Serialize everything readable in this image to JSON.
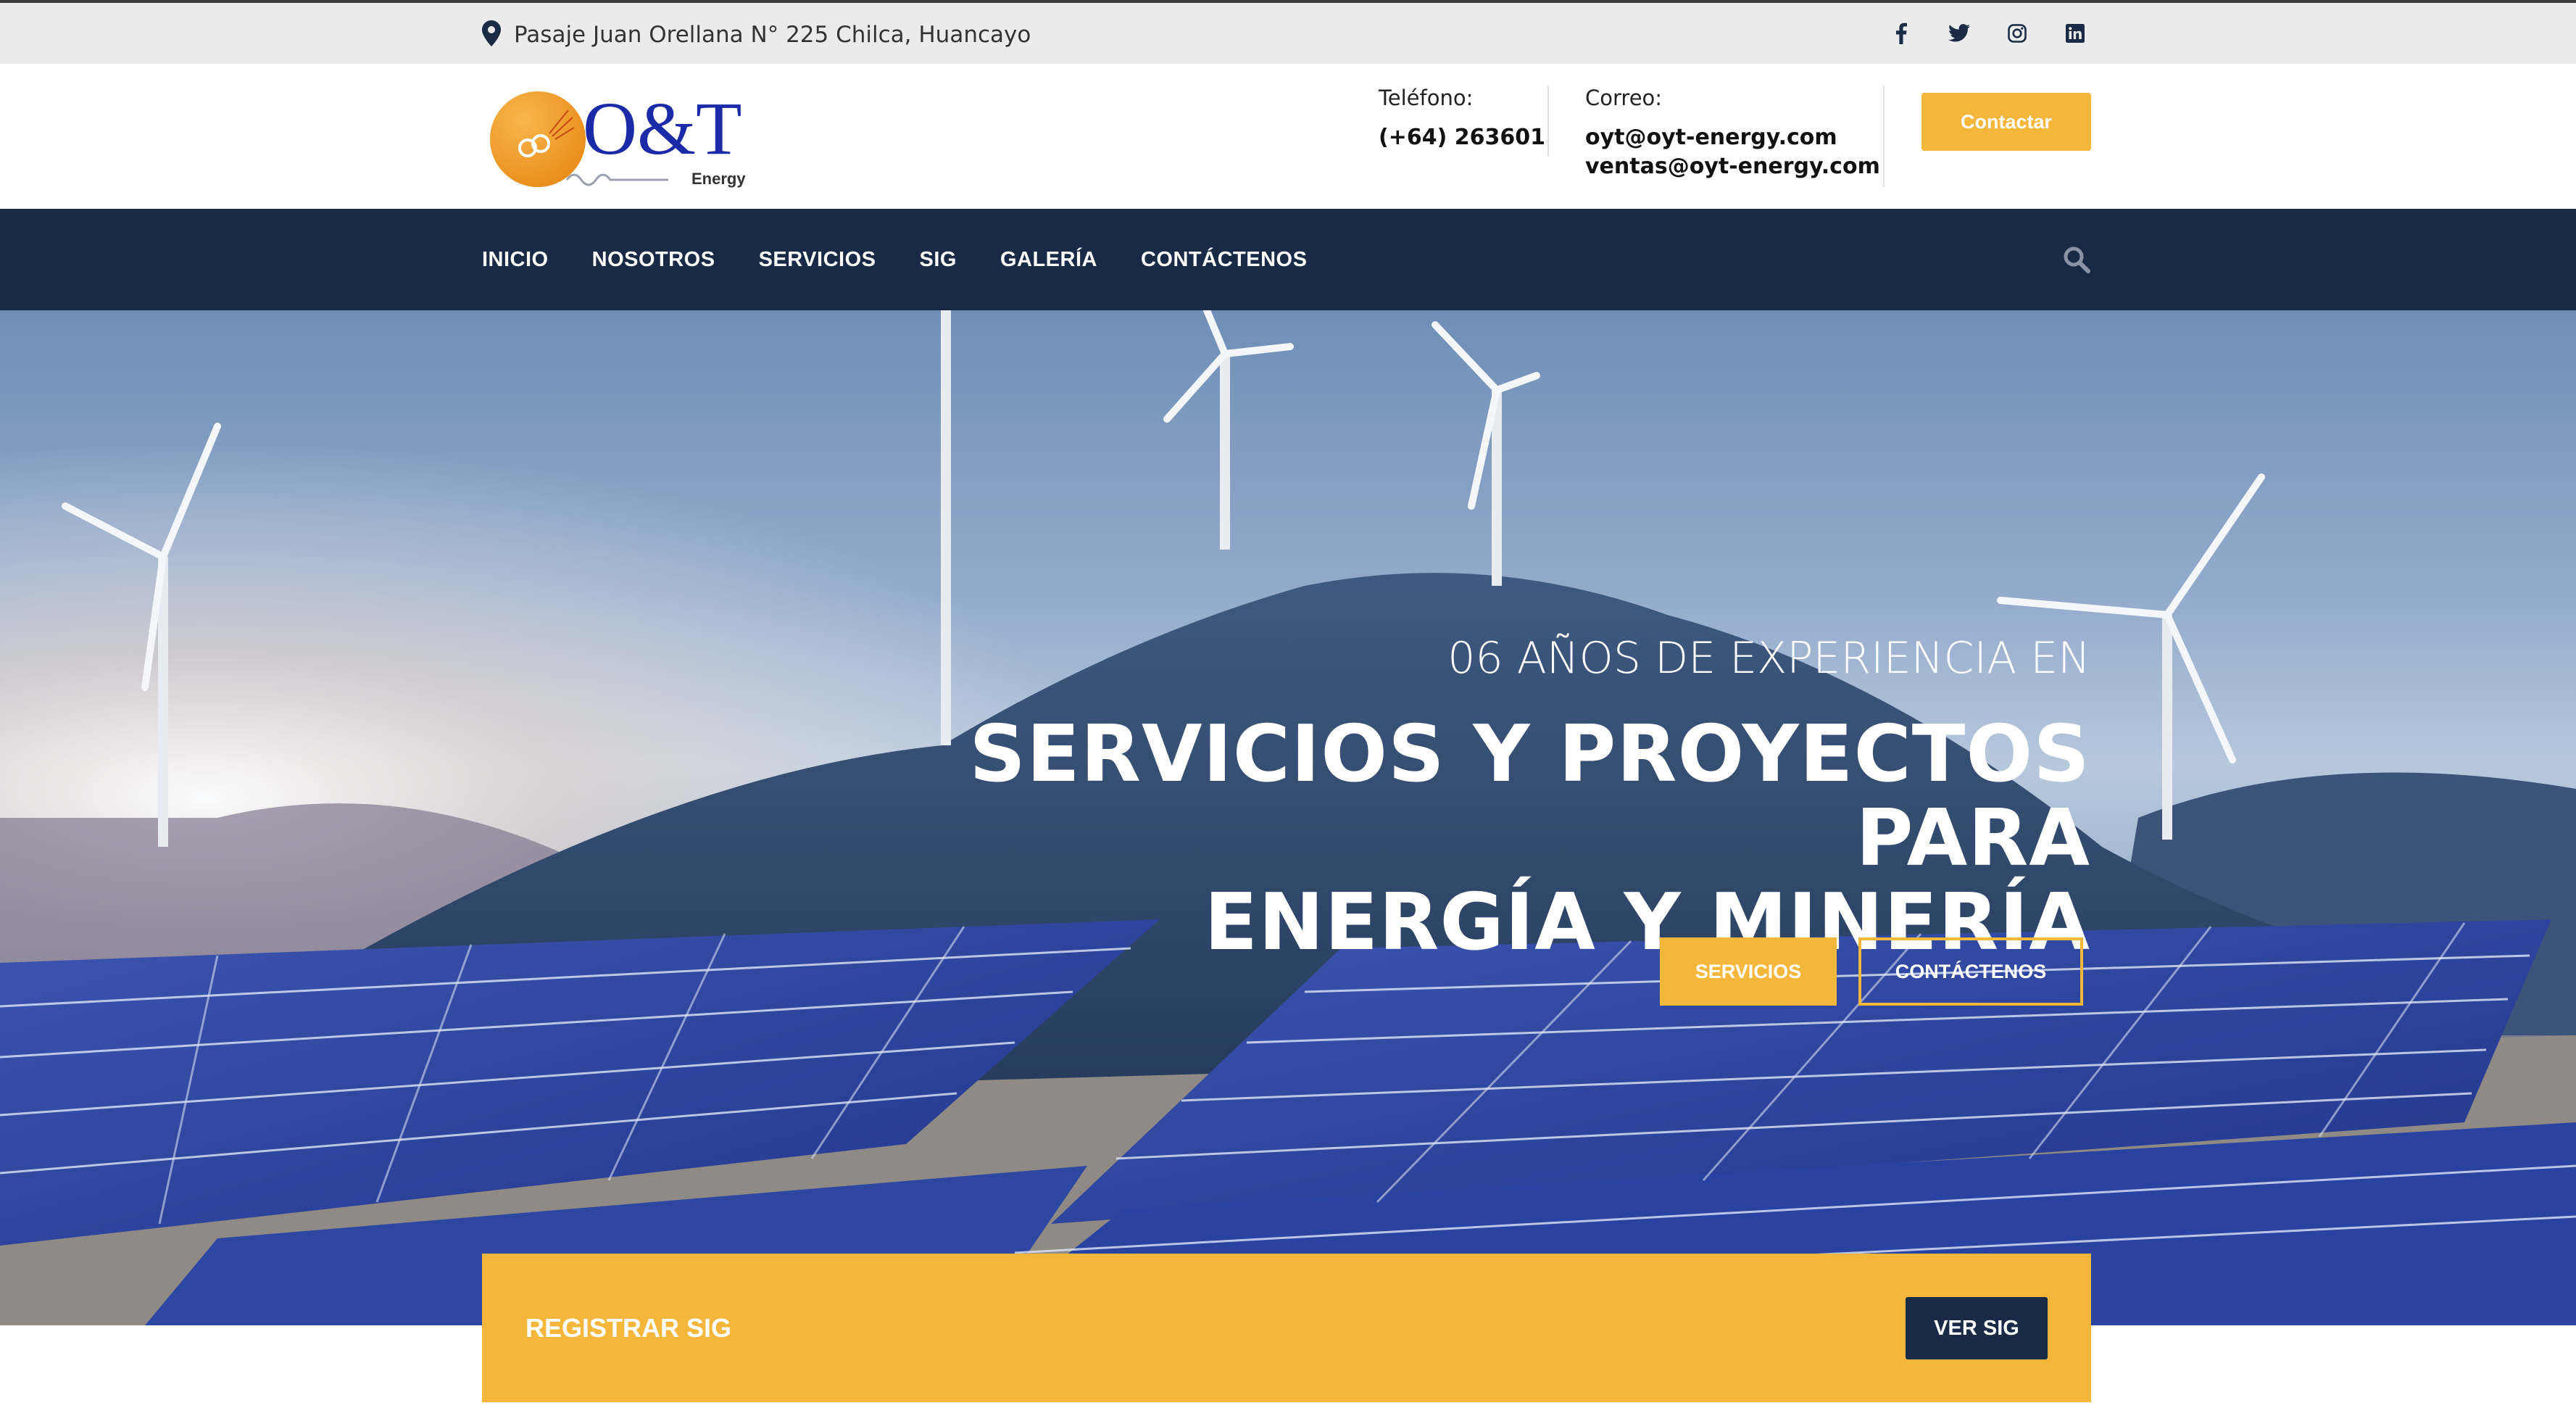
{
  "topbar": {
    "address": "Pasaje Juan Orellana N° 225 Chilca, Huancayo",
    "address_icon": "map-pin-icon",
    "social": [
      "facebook-icon",
      "twitter-icon",
      "instagram-icon",
      "linkedin-icon"
    ]
  },
  "header": {
    "logo_text": "O&T",
    "logo_sub": "Energy",
    "phone_label": "Teléfono:",
    "phone_value": "(+64) 263601",
    "email_label": "Correo:",
    "email_1": "oyt@oyt-energy.com",
    "email_2": "ventas@oyt-energy.com",
    "contact_button": "Contactar"
  },
  "nav": {
    "items": [
      "INICIO",
      "NOSOTROS",
      "SERVICIOS",
      "SIG",
      "GALERÍA",
      "CONTÁCTENOS"
    ],
    "search_icon": "search-icon"
  },
  "hero": {
    "subtitle": "06 AÑOS DE EXPERIENCIA EN",
    "headline_1": "SERVICIOS Y PROYECTOS PARA",
    "headline_2": "ENERGÍA Y MINERÍA",
    "button_primary": "SERVICIOS",
    "button_secondary": "CONTÁCTENOS"
  },
  "sig": {
    "title": "REGISTRAR SIG",
    "button": "VER SIG"
  },
  "colors": {
    "accent": "#f5b63c",
    "navy": "#182a45",
    "topbar": "#ebebeb",
    "logo_blue": "#1b2aa6",
    "logo_orange": "#f09a1e"
  }
}
